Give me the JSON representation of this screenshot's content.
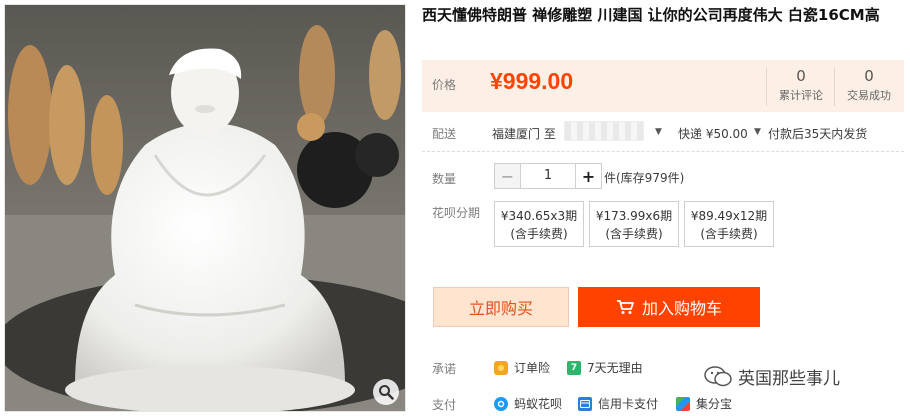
{
  "product": {
    "title": "西天懂佛特朗普 禅修雕塑 川建国 让你的公司再度伟大 白瓷16CM高"
  },
  "price": {
    "label": "价格",
    "value": "¥999.00",
    "color": "#ff4400"
  },
  "stats": [
    {
      "count": "0",
      "label": "累计评论"
    },
    {
      "count": "0",
      "label": "交易成功"
    }
  ],
  "delivery": {
    "label": "配送",
    "from": "福建厦门 至",
    "shipping": "快递 ¥50.00",
    "note": "付款后35天内发货"
  },
  "quantity": {
    "label": "数量",
    "value": "1",
    "minus": "−",
    "plus": "+",
    "stock": "件(库存979件)"
  },
  "installment": {
    "label": "花呗分期",
    "options": [
      {
        "amount": "¥340.65x3期",
        "fee": "(含手续费)"
      },
      {
        "amount": "¥173.99x6期",
        "fee": "(含手续费)"
      },
      {
        "amount": "¥89.49x12期",
        "fee": "(含手续费)"
      }
    ]
  },
  "actions": {
    "buy_now": "立即购买",
    "add_to_cart": "加入购物车",
    "accent": "#ff4200"
  },
  "promise": {
    "label": "承诺",
    "items": [
      {
        "icon": "shield-icon",
        "text": "订单险"
      },
      {
        "icon": "seven-day-return-icon",
        "glyph": "7",
        "text": "7天无理由"
      }
    ]
  },
  "payment": {
    "label": "支付",
    "items": [
      {
        "icon": "huabei-icon",
        "text": "蚂蚁花呗"
      },
      {
        "icon": "credit-card-icon",
        "text": "信用卡支付"
      },
      {
        "icon": "jifenbao-icon",
        "text": "集分宝"
      }
    ]
  },
  "watermark": {
    "text": "英国那些事儿"
  }
}
